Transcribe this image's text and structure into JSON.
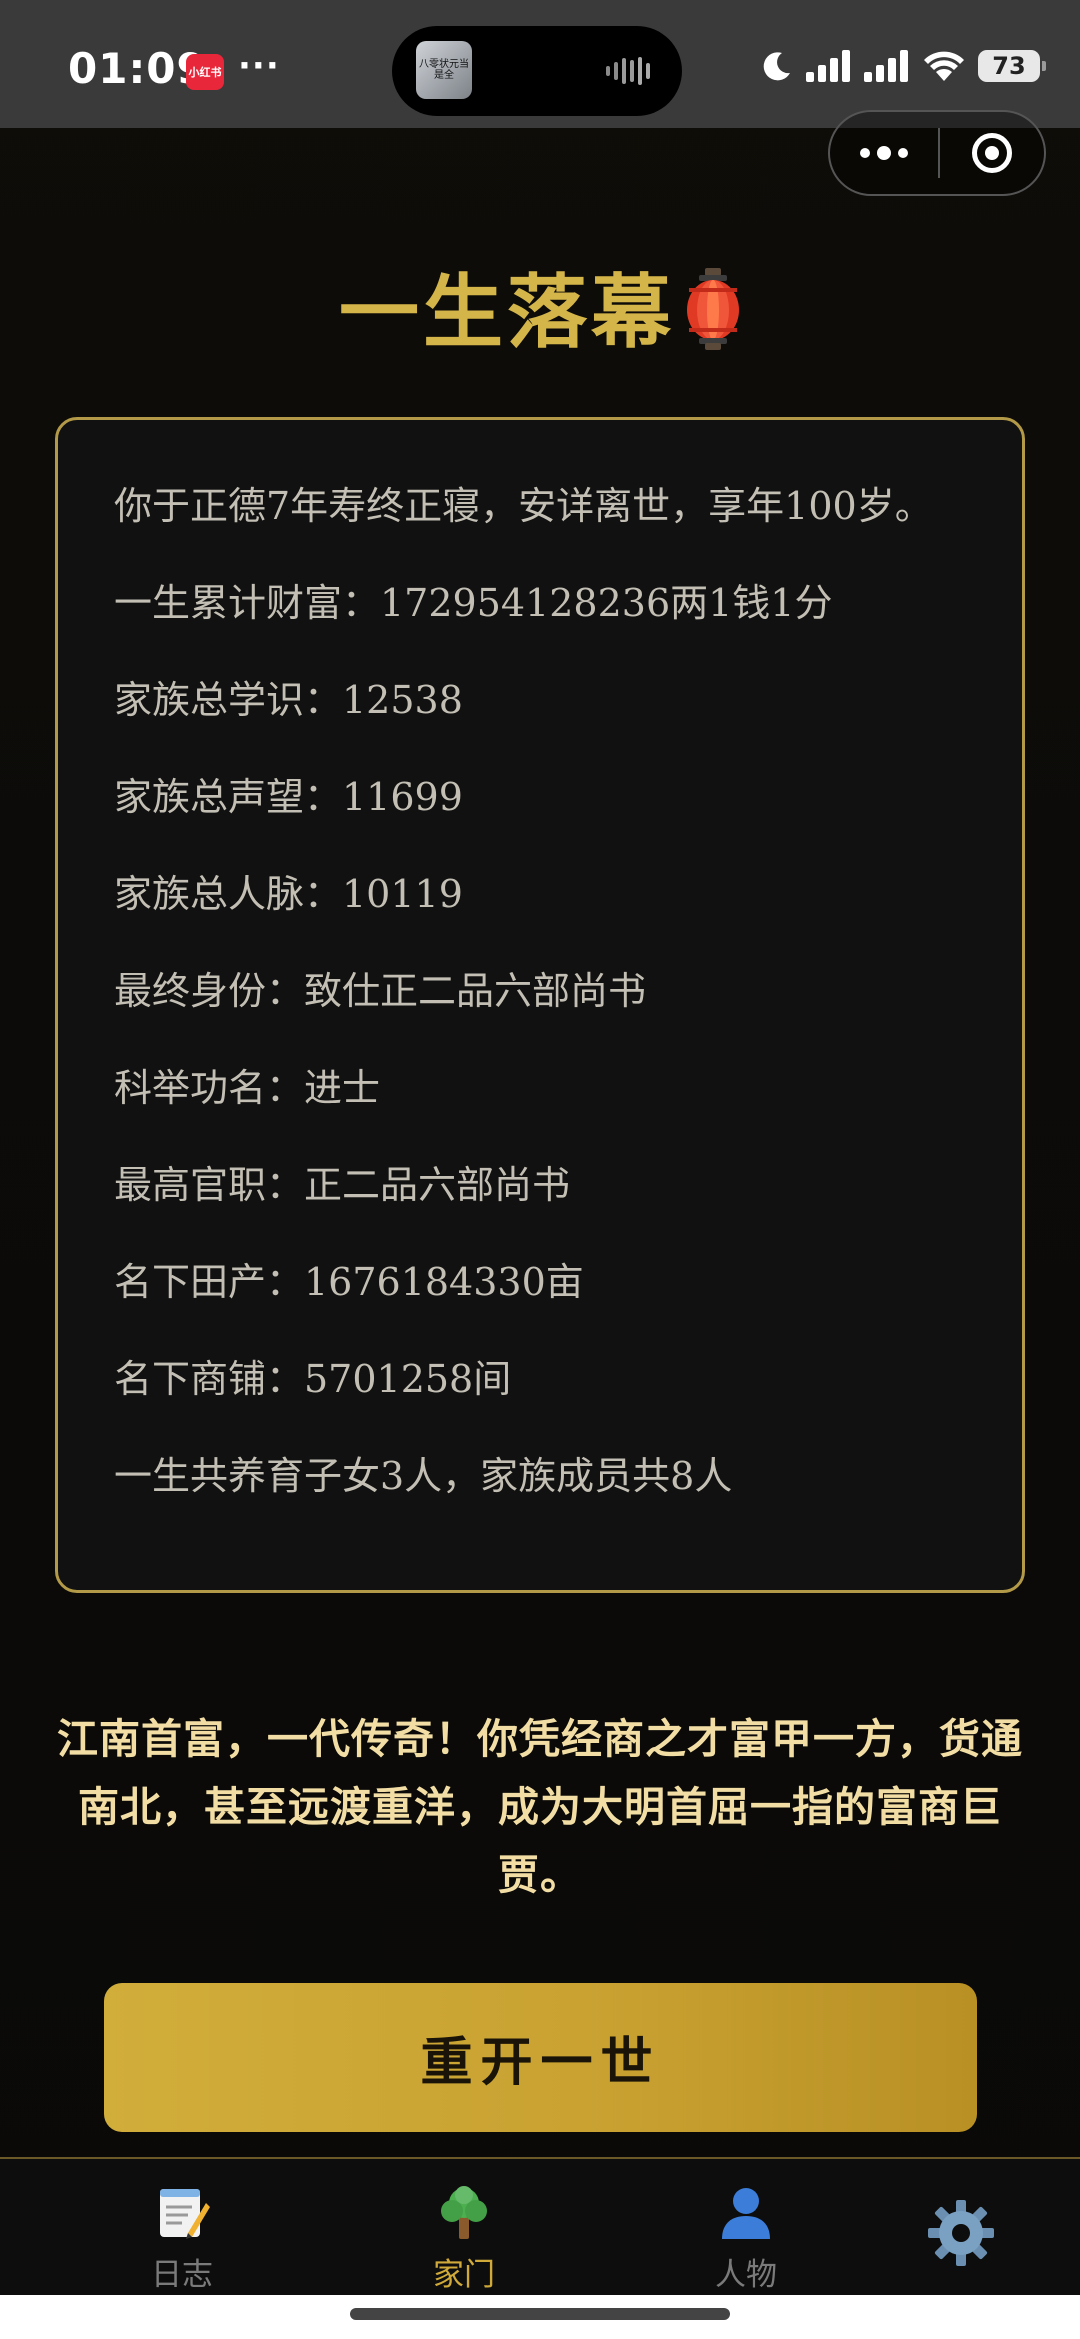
{
  "status_bar": {
    "time": "01:09",
    "app_badge": "小红书",
    "more": "···",
    "island_thumb_text": "八零状元当是全",
    "battery": "73"
  },
  "page": {
    "title": "一生落幕",
    "title_icon": "lantern-icon"
  },
  "summary": {
    "lines": [
      "你于正德7年寿终正寝，安详离世，享年100岁。",
      "一生累计财富：172954128236两1钱1分",
      "家族总学识：12538",
      "家族总声望：11699",
      "家族总人脉：10119",
      "最终身份：致仕正二品六部尚书",
      "科举功名：进士",
      "最高官职：正二品六部尚书",
      "名下田产：1676184330亩",
      "名下商铺：5701258间",
      "一生共养育子女3人，家族成员共8人"
    ]
  },
  "epitaph": "江南首富，一代传奇！你凭经商之才富甲一方，货通南北，甚至远渡重洋，成为大明首屈一指的富商巨贾。",
  "restart_label": "重开一世",
  "tabs": [
    {
      "label": "日志",
      "icon": "memo-icon",
      "active": false
    },
    {
      "label": "家门",
      "icon": "tree-icon",
      "active": true
    },
    {
      "label": "人物",
      "icon": "person-icon",
      "active": false
    }
  ],
  "settings_icon": "gear-icon",
  "colors": {
    "gold": "#d4b54a",
    "card_border": "#b39a48",
    "active_tab": "#cfa93a",
    "button": "#c9a232"
  }
}
